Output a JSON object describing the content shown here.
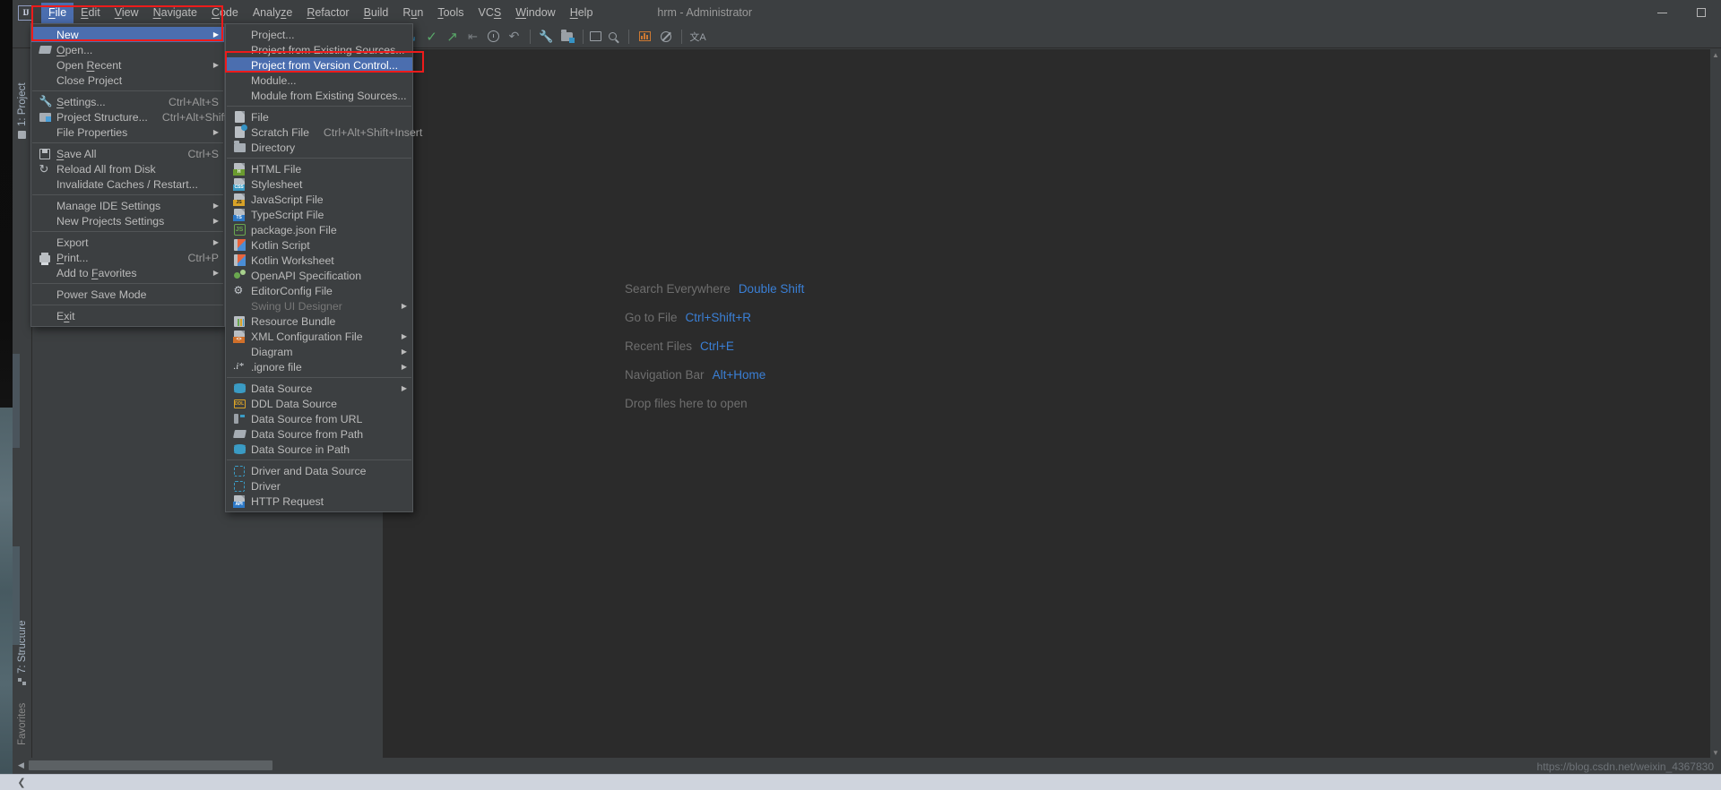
{
  "window": {
    "title": "hrm - Administrator",
    "logo_text": "IJ",
    "minimize_label": "minimize",
    "maximize_label": "maximize"
  },
  "menubar": {
    "items": [
      {
        "label": "File",
        "mnemonic": "F",
        "active": true
      },
      {
        "label": "Edit",
        "mnemonic": "E",
        "active": false
      },
      {
        "label": "View",
        "mnemonic": "V",
        "active": false
      },
      {
        "label": "Navigate",
        "mnemonic": "N",
        "active": false
      },
      {
        "label": "Code",
        "mnemonic": "C",
        "active": false
      },
      {
        "label": "Analyze",
        "mnemonic": "z",
        "active": false
      },
      {
        "label": "Refactor",
        "mnemonic": "R",
        "active": false
      },
      {
        "label": "Build",
        "mnemonic": "B",
        "active": false
      },
      {
        "label": "Run",
        "mnemonic": "u",
        "active": false
      },
      {
        "label": "Tools",
        "mnemonic": "T",
        "active": false
      },
      {
        "label": "VCS",
        "mnemonic": "S",
        "active": false
      },
      {
        "label": "Window",
        "mnemonic": "W",
        "active": false
      },
      {
        "label": "Help",
        "mnemonic": "H",
        "active": false
      }
    ]
  },
  "toolbar": {
    "icons": [
      "open-folder-icon",
      "project-structure-icon",
      "commit-icon",
      "update-project-icon",
      "push-icon",
      "rollback-icon",
      "history-icon",
      "undo-icon",
      "settings-wrench-icon",
      "project-structure-toolbar-icon",
      "terminal-icon",
      "search-everywhere-icon",
      "run-config-icon",
      "stop-icon",
      "translate-icon"
    ]
  },
  "file_menu": {
    "items": [
      {
        "label": "New",
        "mnemonic": "N",
        "icon": "",
        "shortcut": "",
        "submenu": true,
        "selected": true,
        "disabled": false
      },
      {
        "label": "Open...",
        "mnemonic": "O",
        "icon": "folder-open-icon",
        "shortcut": "",
        "submenu": false,
        "selected": false,
        "disabled": false
      },
      {
        "label": "Open Recent",
        "mnemonic": "R",
        "icon": "",
        "shortcut": "",
        "submenu": true,
        "selected": false,
        "disabled": false
      },
      {
        "label": "Close Project",
        "mnemonic": "",
        "icon": "",
        "shortcut": "",
        "submenu": false,
        "selected": false,
        "disabled": false
      },
      {
        "separator": true
      },
      {
        "label": "Settings...",
        "mnemonic": "S",
        "icon": "wrench-icon",
        "shortcut": "Ctrl+Alt+S",
        "submenu": false,
        "selected": false,
        "disabled": false
      },
      {
        "label": "Project Structure...",
        "mnemonic": "",
        "icon": "project-structure-icon",
        "shortcut": "Ctrl+Alt+Shift+S",
        "submenu": false,
        "selected": false,
        "disabled": false
      },
      {
        "label": "File Properties",
        "mnemonic": "",
        "icon": "",
        "shortcut": "",
        "submenu": true,
        "selected": false,
        "disabled": false
      },
      {
        "separator": true
      },
      {
        "label": "Save All",
        "mnemonic": "S",
        "icon": "save-icon",
        "shortcut": "Ctrl+S",
        "submenu": false,
        "selected": false,
        "disabled": false
      },
      {
        "label": "Reload All from Disk",
        "mnemonic": "",
        "icon": "reload-icon",
        "shortcut": "",
        "submenu": false,
        "selected": false,
        "disabled": false
      },
      {
        "label": "Invalidate Caches / Restart...",
        "mnemonic": "",
        "icon": "",
        "shortcut": "",
        "submenu": false,
        "selected": false,
        "disabled": false
      },
      {
        "separator": true
      },
      {
        "label": "Manage IDE Settings",
        "mnemonic": "",
        "icon": "",
        "shortcut": "",
        "submenu": true,
        "selected": false,
        "disabled": false
      },
      {
        "label": "New Projects Settings",
        "mnemonic": "",
        "icon": "",
        "shortcut": "",
        "submenu": true,
        "selected": false,
        "disabled": false
      },
      {
        "separator": true
      },
      {
        "label": "Export",
        "mnemonic": "",
        "icon": "",
        "shortcut": "",
        "submenu": true,
        "selected": false,
        "disabled": false
      },
      {
        "label": "Print...",
        "mnemonic": "P",
        "icon": "print-icon",
        "shortcut": "Ctrl+P",
        "submenu": false,
        "selected": false,
        "disabled": false
      },
      {
        "label": "Add to Favorites",
        "mnemonic": "F",
        "icon": "",
        "shortcut": "",
        "submenu": true,
        "selected": false,
        "disabled": false
      },
      {
        "separator": true
      },
      {
        "label": "Power Save Mode",
        "mnemonic": "",
        "icon": "",
        "shortcut": "",
        "submenu": false,
        "selected": false,
        "disabled": false
      },
      {
        "separator": true
      },
      {
        "label": "Exit",
        "mnemonic": "x",
        "icon": "",
        "shortcut": "",
        "submenu": false,
        "selected": false,
        "disabled": false
      }
    ]
  },
  "new_submenu": {
    "items": [
      {
        "label": "Project...",
        "icon": "",
        "shortcut": "",
        "selected": false,
        "disabled": false
      },
      {
        "label": "Project from Existing Sources...",
        "icon": "",
        "shortcut": "",
        "selected": false,
        "disabled": false
      },
      {
        "label": "Project from Version Control...",
        "icon": "",
        "shortcut": "",
        "selected": true,
        "disabled": false
      },
      {
        "label": "Module...",
        "icon": "",
        "shortcut": "",
        "selected": false,
        "disabled": false
      },
      {
        "label": "Module from Existing Sources...",
        "icon": "",
        "shortcut": "",
        "selected": false,
        "disabled": false
      },
      {
        "separator": true
      },
      {
        "label": "File",
        "icon": "file-icon",
        "shortcut": "",
        "selected": false,
        "disabled": false
      },
      {
        "label": "Scratch File",
        "icon": "scratch-file-icon",
        "shortcut": "Ctrl+Alt+Shift+Insert",
        "selected": false,
        "disabled": false
      },
      {
        "label": "Directory",
        "icon": "directory-icon",
        "shortcut": "",
        "selected": false,
        "disabled": false
      },
      {
        "separator": true
      },
      {
        "label": "HTML File",
        "icon": "html-file-icon",
        "shortcut": "",
        "selected": false,
        "disabled": false
      },
      {
        "label": "Stylesheet",
        "icon": "stylesheet-icon",
        "shortcut": "",
        "selected": false,
        "disabled": false
      },
      {
        "label": "JavaScript File",
        "icon": "javascript-file-icon",
        "shortcut": "",
        "selected": false,
        "disabled": false
      },
      {
        "label": "TypeScript File",
        "icon": "typescript-file-icon",
        "shortcut": "",
        "selected": false,
        "disabled": false
      },
      {
        "label": "package.json File",
        "icon": "package-json-icon",
        "shortcut": "",
        "selected": false,
        "disabled": false
      },
      {
        "label": "Kotlin Script",
        "icon": "kotlin-script-icon",
        "shortcut": "",
        "selected": false,
        "disabled": false
      },
      {
        "label": "Kotlin Worksheet",
        "icon": "kotlin-worksheet-icon",
        "shortcut": "",
        "selected": false,
        "disabled": false
      },
      {
        "label": "OpenAPI Specification",
        "icon": "openapi-icon",
        "shortcut": "",
        "selected": false,
        "disabled": false
      },
      {
        "label": "EditorConfig File",
        "icon": "editorconfig-icon",
        "shortcut": "",
        "selected": false,
        "disabled": false
      },
      {
        "label": "Swing UI Designer",
        "icon": "",
        "shortcut": "",
        "selected": false,
        "disabled": true,
        "submenu": true
      },
      {
        "label": "Resource Bundle",
        "icon": "resource-bundle-icon",
        "shortcut": "",
        "selected": false,
        "disabled": false
      },
      {
        "label": "XML Configuration File",
        "icon": "xml-config-icon",
        "shortcut": "",
        "selected": false,
        "disabled": false,
        "submenu": true
      },
      {
        "label": "Diagram",
        "icon": "",
        "shortcut": "",
        "selected": false,
        "disabled": false,
        "submenu": true
      },
      {
        "label": ".ignore file",
        "icon": "ignore-file-icon",
        "shortcut": "",
        "selected": false,
        "disabled": false,
        "submenu": true
      },
      {
        "separator": true
      },
      {
        "label": "Data Source",
        "icon": "data-source-icon",
        "shortcut": "",
        "selected": false,
        "disabled": false,
        "submenu": true
      },
      {
        "label": "DDL Data Source",
        "icon": "ddl-data-source-icon",
        "shortcut": "",
        "selected": false,
        "disabled": false
      },
      {
        "label": "Data Source from URL",
        "icon": "data-source-url-icon",
        "shortcut": "",
        "selected": false,
        "disabled": false
      },
      {
        "label": "Data Source from Path",
        "icon": "data-source-path-icon",
        "shortcut": "",
        "selected": false,
        "disabled": false
      },
      {
        "label": "Data Source in Path",
        "icon": "data-source-in-path-icon",
        "shortcut": "",
        "selected": false,
        "disabled": false
      },
      {
        "separator": true
      },
      {
        "label": "Driver and Data Source",
        "icon": "driver-data-source-icon",
        "shortcut": "",
        "selected": false,
        "disabled": false
      },
      {
        "label": "Driver",
        "icon": "driver-icon",
        "shortcut": "",
        "selected": false,
        "disabled": false
      },
      {
        "label": "HTTP Request",
        "icon": "http-request-icon",
        "shortcut": "",
        "selected": false,
        "disabled": false
      }
    ]
  },
  "tool_windows": {
    "project_tab": "1: Project",
    "structure_tab": "7: Structure",
    "favorites_tab": "Favorites"
  },
  "editor": {
    "tips": [
      {
        "label": "Search Everywhere",
        "key": "Double Shift"
      },
      {
        "label": "Go to File",
        "key": "Ctrl+Shift+R"
      },
      {
        "label": "Recent Files",
        "key": "Ctrl+E"
      },
      {
        "label": "Navigation Bar",
        "key": "Alt+Home"
      },
      {
        "label": "Drop files here to open",
        "key": ""
      }
    ]
  },
  "status": {
    "watermark": "https://blog.csdn.net/weixin_4367830"
  },
  "colors": {
    "accent_selection": "#4b6eaf",
    "panel_bg": "#3c3f41",
    "editor_bg": "#2b2b2b",
    "text": "#bbbbbb",
    "key_link": "#3a7fd5",
    "annotation": "#ee1b1b"
  }
}
